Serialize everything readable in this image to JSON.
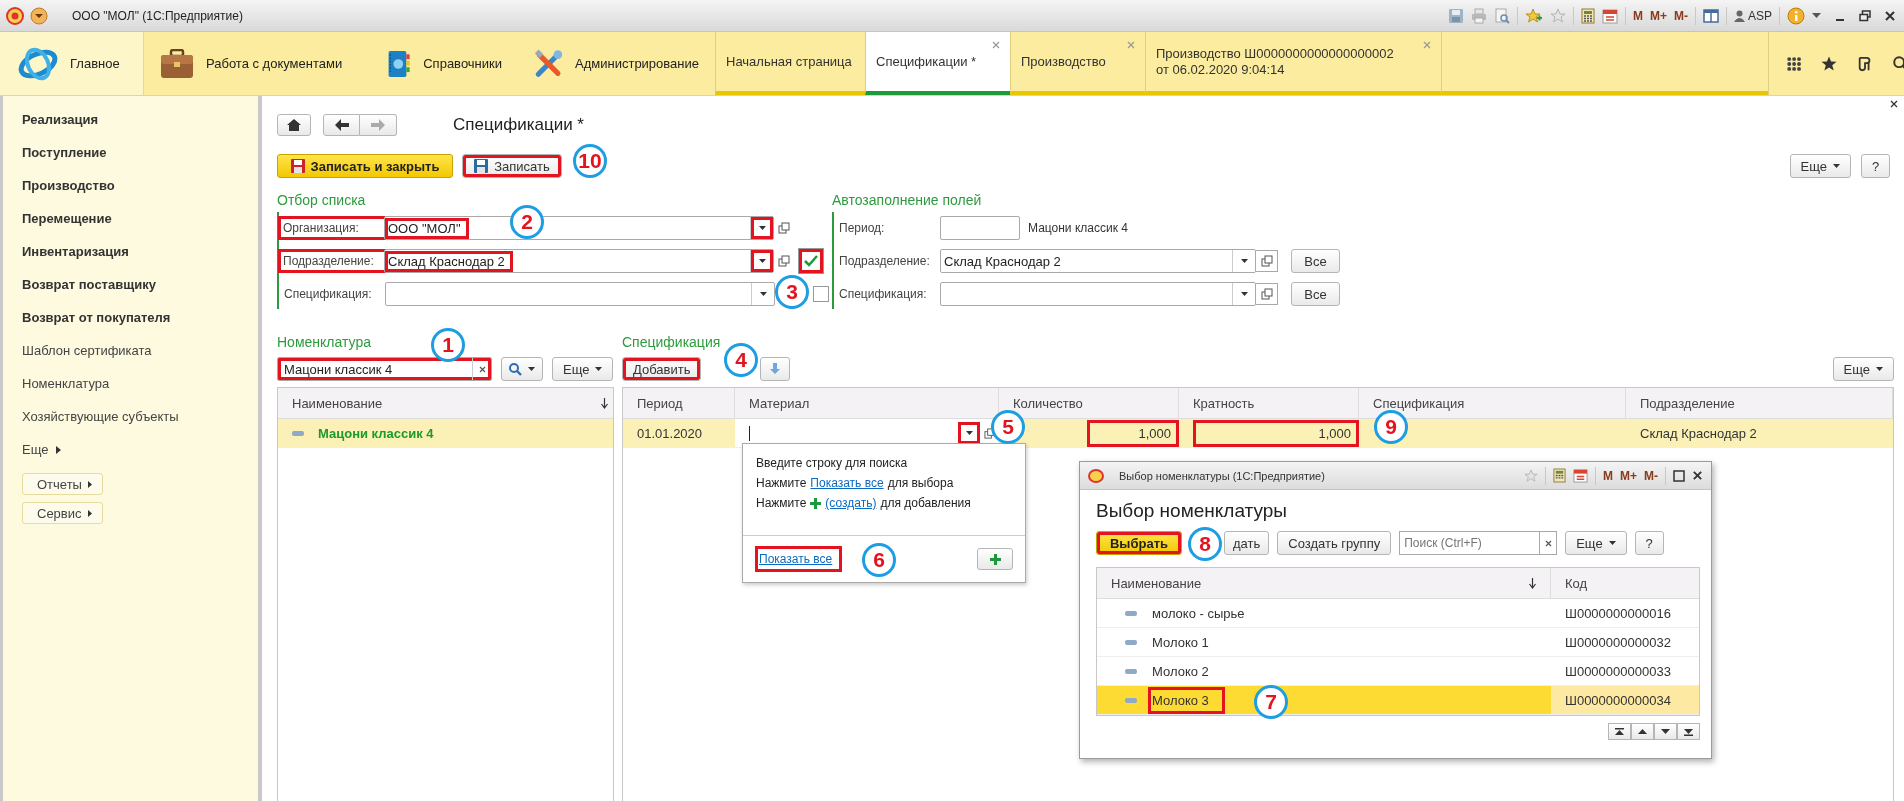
{
  "window": {
    "title": "ООО \"МОЛ\" (1С:Предприятие)",
    "memory_buttons": [
      "M",
      "M+",
      "M-"
    ],
    "user": "ASP"
  },
  "sections": [
    {
      "label": "Главное"
    },
    {
      "label": "Работа с документами"
    },
    {
      "label": "Справочники"
    },
    {
      "label": "Администрирование"
    }
  ],
  "tabs": [
    {
      "label": "Начальная страница",
      "selected": false,
      "closable": false
    },
    {
      "label": "Спецификации *",
      "selected": true,
      "closable": true
    },
    {
      "label": "Производство",
      "selected": false,
      "closable": true
    },
    {
      "label": "Производство Ш0000000000000000002 от 06.02.2020 9:04:14",
      "selected": false,
      "closable": true
    }
  ],
  "sidebar": {
    "items": [
      {
        "label": "Реализация",
        "emphasized": true
      },
      {
        "label": "Поступление",
        "emphasized": true
      },
      {
        "label": "Производство",
        "emphasized": true
      },
      {
        "label": "Перемещение",
        "emphasized": true
      },
      {
        "label": "Инвентаризация",
        "emphasized": true
      },
      {
        "label": "Возврат поставщику",
        "emphasized": true
      },
      {
        "label": "Возврат от покупателя",
        "emphasized": true
      },
      {
        "label": "Шаблон сертификата",
        "emphasized": false
      },
      {
        "label": "Номенклатура",
        "emphasized": false
      },
      {
        "label": "Хозяйствующие субъекты",
        "emphasized": false
      }
    ],
    "more": "Еще",
    "buttons": [
      "Отчеты",
      "Сервис"
    ]
  },
  "form": {
    "title": "Спецификации *",
    "buttons": [
      {
        "label": "Записать и закрыть",
        "kind": "primary"
      },
      {
        "label": "Записать",
        "kind": "plain"
      }
    ],
    "more": "Еще",
    "help": "?",
    "list_filter": {
      "title": "Отбор списка",
      "fields": [
        {
          "label": "Организация:",
          "value": "ООО \"МОЛ\"",
          "kind": "plain"
        },
        {
          "label": "Подразделение:",
          "value": "Склад Краснодар 2",
          "kind": "checkable",
          "checked": true
        },
        {
          "label": "Спецификация:",
          "kind": "checkable",
          "checked": false
        }
      ]
    },
    "autofill": {
      "title": "Автозаполнение полей",
      "period_label": "Период:",
      "period_note": "Мацони классик 4",
      "fields": [
        {
          "label": "Подразделение:",
          "value": "Склад Краснодар 2",
          "button": "Все"
        },
        {
          "label": "Спецификация:",
          "button": "Все"
        }
      ]
    },
    "nomenclature": {
      "title": "Номенклатура",
      "search_value": "Мацони классик 4",
      "more": "Еще",
      "columns": [
        "Наименование"
      ],
      "rows": [
        {
          "name": "Мацони классик 4",
          "selected": true
        }
      ]
    },
    "specification": {
      "title": "Спецификация",
      "add": "Добавить",
      "more": "Еще",
      "columns": [
        "Период",
        "Материал",
        "Количество",
        "Кратность",
        "Спецификация",
        "Подразделение"
      ],
      "rows": [
        {
          "period": "01.01.2020",
          "editing": true,
          "quantity": "1,000",
          "multiplicity": "1,000",
          "subdivision": "Склад Краснодар 2",
          "selected": true
        }
      ]
    }
  },
  "dropdown": {
    "hint": "Введите строку для поиска",
    "lines": [
      {
        "before": "Нажмите",
        "icon": false,
        "link": "Показать все",
        "after": "для выбора"
      },
      {
        "before": "Нажмите",
        "icon": true,
        "link": "(создать)",
        "after": "для добавления"
      }
    ],
    "footer_link": "Показать все"
  },
  "dialog": {
    "window_title": "Выбор номенклатуры (1С:Предприятие)",
    "memory_buttons": [
      "M",
      "M+",
      "M-"
    ],
    "heading": "Выбор номенклатуры",
    "buttons": [
      {
        "label": "Выбрать",
        "kind": "primary"
      },
      {
        "label": "дать",
        "kind": "plain"
      },
      {
        "label": "Создать группу",
        "kind": "plain"
      }
    ],
    "search_placeholder": "Поиск (Ctrl+F)",
    "more": "Еще",
    "help": "?",
    "columns": [
      "Наименование",
      "Код"
    ],
    "rows": [
      {
        "name": "молоко - сырье",
        "code": "Ш0000000000016",
        "selected": false
      },
      {
        "name": "Молоко 1",
        "code": "Ш0000000000032",
        "selected": false
      },
      {
        "name": "Молоко 2",
        "code": "Ш0000000000033",
        "selected": false
      },
      {
        "name": "Молоко 3",
        "code": "Ш0000000000034",
        "selected": true
      }
    ]
  },
  "annotations": [
    {
      "number": "1"
    },
    {
      "number": "2"
    },
    {
      "number": "3"
    },
    {
      "number": "4"
    },
    {
      "number": "5"
    },
    {
      "number": "6"
    },
    {
      "number": "7"
    },
    {
      "number": "8"
    },
    {
      "number": "9"
    },
    {
      "number": "10"
    }
  ]
}
